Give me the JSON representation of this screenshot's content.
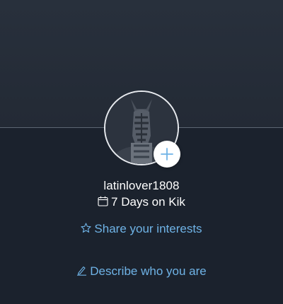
{
  "profile": {
    "username": "latinlover1808",
    "days_on_kik": "7 Days on Kik"
  },
  "actions": {
    "share_interests_label": "Share your interests",
    "describe_label": "Describe who you are"
  },
  "icons": {
    "add_photo": "plus-icon",
    "calendar": "calendar-icon",
    "interests": "star-icon",
    "describe": "pencil-icon"
  },
  "colors": {
    "background": "#1b222d",
    "header_background": "#262e3a",
    "link_accent": "#6fb3e6",
    "text": "#ffffff"
  }
}
